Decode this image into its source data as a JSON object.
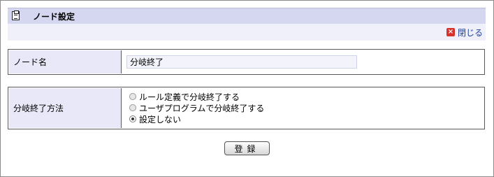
{
  "header": {
    "title": "ノード設定",
    "icon": "clipboard-icon",
    "close_icon": "close-x-icon",
    "close_label": "閉じる",
    "colors": {
      "title_bg": "#d5d6ef",
      "sub_bg": "#f0f0fb",
      "close_icon": "#d8332b"
    }
  },
  "form": {
    "node_name": {
      "label": "ノード名",
      "value": "分岐終了"
    },
    "branch_end_method": {
      "label": "分岐終了方法",
      "options": [
        {
          "label": "ルール定義で分岐終了する",
          "selected": false
        },
        {
          "label": "ユーザプログラムで分岐終了する",
          "selected": false
        },
        {
          "label": "設定しない",
          "selected": true
        }
      ]
    }
  },
  "actions": {
    "register_label": "登録"
  }
}
